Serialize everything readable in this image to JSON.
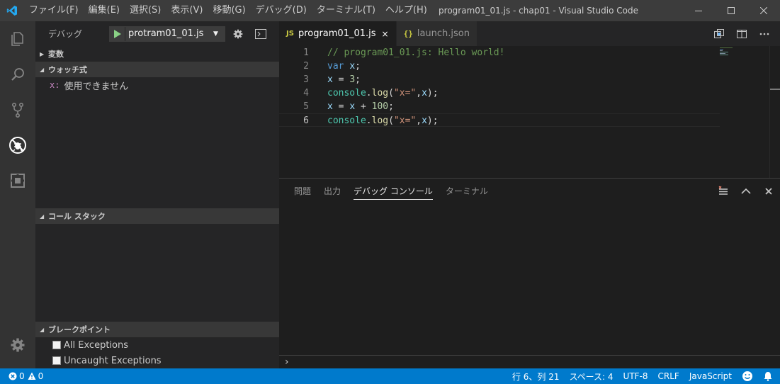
{
  "titlebar": {
    "menu": [
      "ファイル(F)",
      "編集(E)",
      "選択(S)",
      "表示(V)",
      "移動(G)",
      "デバッグ(D)",
      "ターミナル(T)",
      "ヘルプ(H)"
    ],
    "window_title": "program01_01.js - chap01 - Visual Studio Code"
  },
  "activitybar": {
    "items": [
      "files-icon",
      "search-icon",
      "source-control-icon",
      "debug-icon",
      "extensions-icon"
    ],
    "settings": "gear-icon"
  },
  "sidebar": {
    "title": "デバッグ",
    "launch_config": "protram01_01.js",
    "sections": {
      "variables": "変数",
      "watch": "ウォッチ式",
      "call_stack": "コール スタック",
      "breakpoints": "ブレークポイント"
    },
    "watch_items": [
      {
        "name": "x:",
        "value": "使用できません"
      }
    ],
    "breakpoints": [
      {
        "label": "All Exceptions",
        "checked": false
      },
      {
        "label": "Uncaught Exceptions",
        "checked": false
      }
    ]
  },
  "editor": {
    "tabs": [
      {
        "label": "program01_01.js",
        "icon": "JS",
        "active": true,
        "close": "×"
      },
      {
        "label": "launch.json",
        "icon": "{}",
        "active": false
      }
    ],
    "line_numbers": [
      "1",
      "2",
      "3",
      "4",
      "5",
      "6"
    ],
    "current_line": 6
  },
  "panel": {
    "tabs": [
      "問題",
      "出力",
      "デバッグ コンソール",
      "ターミナル"
    ],
    "active_tab": "デバッグ コンソール",
    "prompt": "›"
  },
  "statusbar": {
    "errors": "0",
    "warnings": "0",
    "position": "行 6、列 21",
    "indent": "スペース: 4",
    "encoding": "UTF-8",
    "eol": "CRLF",
    "language": "JavaScript"
  },
  "colors": {
    "accent": "#007acc",
    "activitybar": "#333333",
    "sidebar": "#252526",
    "editor": "#1e1e1e",
    "titlebar": "#3c3c3c",
    "play": "#89d185"
  }
}
